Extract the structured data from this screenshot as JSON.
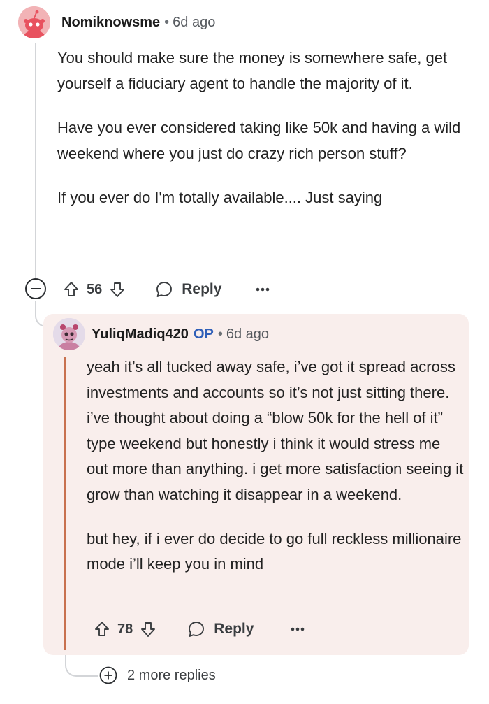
{
  "comment": {
    "username": "Nomiknowsme",
    "separator": "•",
    "age": "6d ago",
    "paragraphs": [
      "You should make sure the money is somewhere safe, get yourself a fiduciary agent to handle the majority of it.",
      "Have you ever considered taking like 50k and having a wild weekend where you just do crazy rich person stuff?",
      "If you ever do I'm totally available.... Just saying"
    ],
    "score": "56",
    "reply_label": "Reply",
    "more_label": "···"
  },
  "reply": {
    "username": "YuliqMadiq420",
    "op_badge": "OP",
    "separator": "•",
    "age": "6d ago",
    "paragraphs": [
      "yeah it’s all tucked away safe, i’ve got it spread across investments and accounts so it’s not just sitting there. i’ve thought about doing a “blow 50k for the hell of it” type weekend but honestly i think it would stress me out more than anything. i get more satisfaction seeing it grow than watching it disappear in a weekend.",
      "but hey, if i ever do decide to go full reckless millionaire mode i’ll keep you in mind"
    ],
    "score": "78",
    "reply_label": "Reply",
    "more_label": "···"
  },
  "more_replies": {
    "label": "2 more replies"
  },
  "colors": {
    "reply_background": "#f9eeec",
    "op_accent": "#c8714f",
    "op_badge": "#2f5fb8",
    "thread_line": "#d3d5d8"
  },
  "icons": {
    "avatar1": "reddit-snoo-avatar-icon",
    "avatar2": "user-avatar-icon",
    "collapse": "minus-circle-icon",
    "upvote": "arrow-up-icon",
    "downvote": "arrow-down-icon",
    "reply": "speech-bubble-icon",
    "more": "ellipsis-icon",
    "expand": "plus-circle-icon"
  }
}
